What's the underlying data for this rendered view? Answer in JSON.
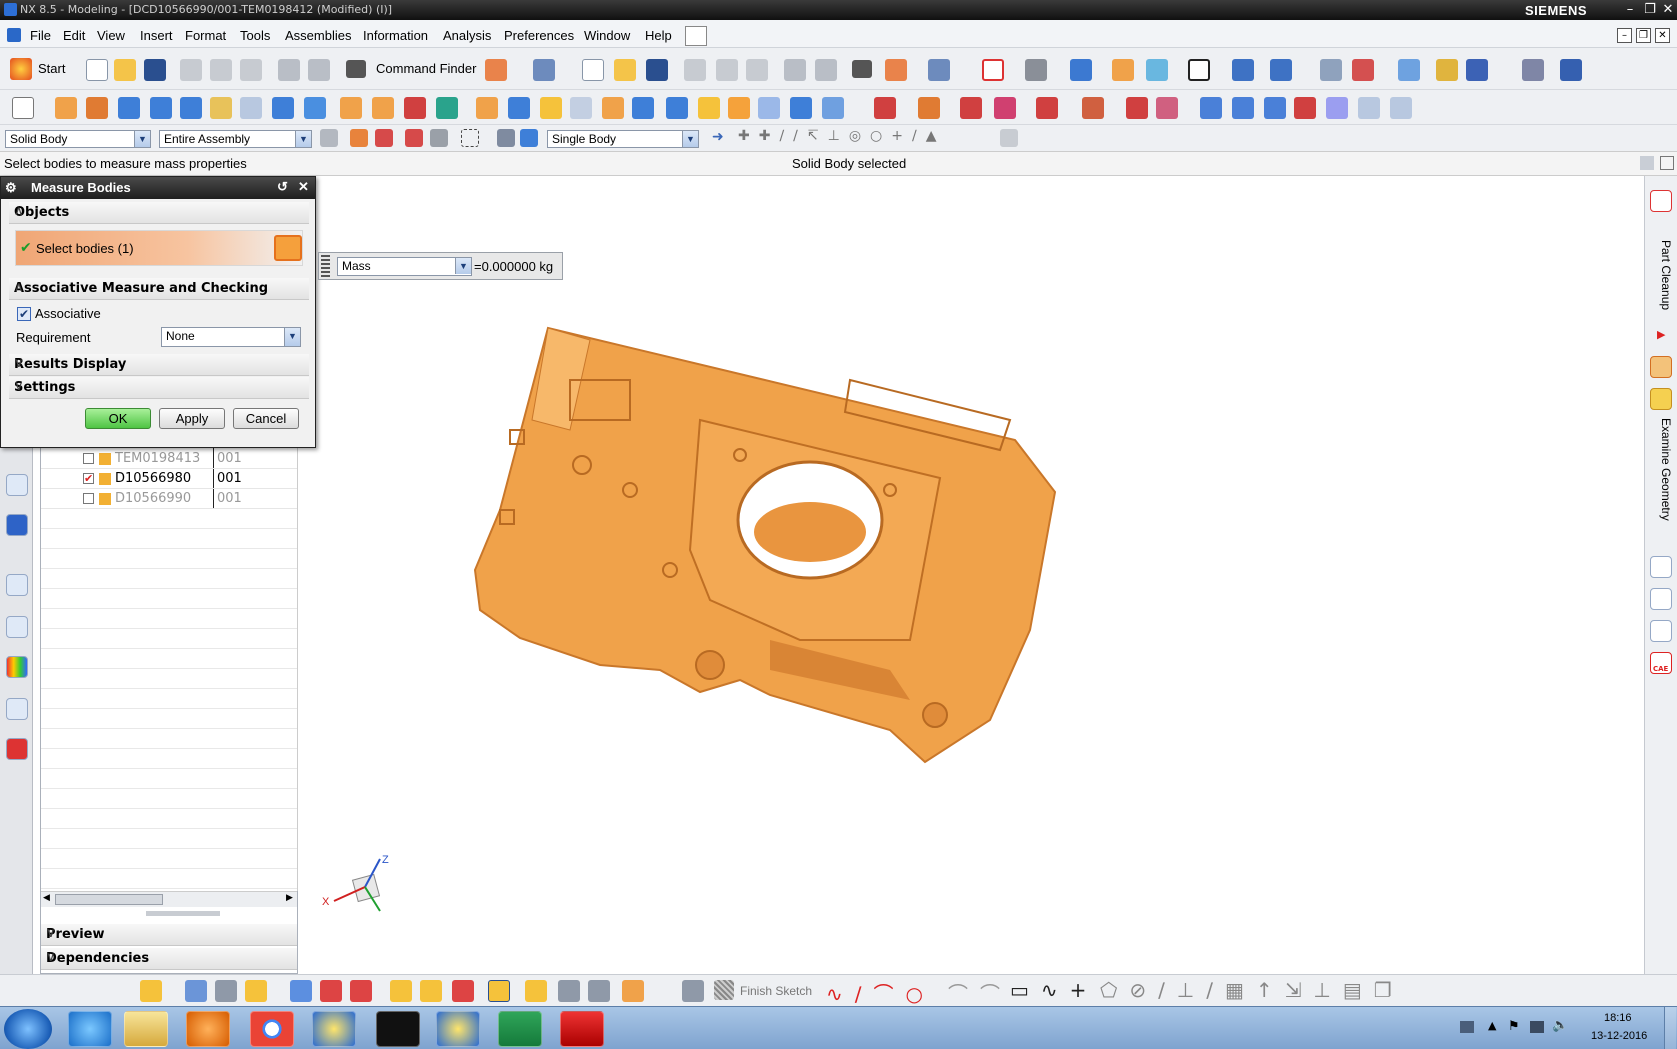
{
  "window": {
    "title": "NX 8.5 - Modeling - [DCD10566990/001-TEM0198412 (Modified)   (I)]",
    "brand": "SIEMENS"
  },
  "menu": [
    "File",
    "Edit",
    "View",
    "Insert",
    "Format",
    "Tools",
    "Assemblies",
    "Information",
    "Analysis",
    "Preferences",
    "Window",
    "Help"
  ],
  "toolbar": {
    "start_label": "Start",
    "command_finder_label": "Command Finder"
  },
  "selection_bar": {
    "type_filter": "Solid Body",
    "scope": "Entire Assembly",
    "body_rule": "Single Body"
  },
  "cue_line": {
    "prompt": "Select bodies to measure mass properties",
    "status": "Solid Body selected"
  },
  "dialog": {
    "title": "Measure Bodies",
    "objects_group": "Objects",
    "select_bodies_label": "Select bodies (1)",
    "assoc_group": "Associative Measure and Checking",
    "associative_label": "Associative",
    "associative_checked": true,
    "requirement_label": "Requirement",
    "requirement_value": "None",
    "results_group": "Results Display",
    "settings_group": "Settings",
    "ok_label": "OK",
    "apply_label": "Apply",
    "cancel_label": "Cancel"
  },
  "measure_readout": {
    "quantity": "Mass",
    "value": "=0.000000 kg"
  },
  "navigator": {
    "rows": [
      {
        "name": "TEM0198413",
        "rev": "001",
        "checked": false,
        "dim": true
      },
      {
        "name": "D10566980",
        "rev": "001",
        "checked": true,
        "dim": false
      },
      {
        "name": "D10566990",
        "rev": "001",
        "checked": false,
        "dim": true
      }
    ],
    "preview_label": "Preview",
    "dependencies_label": "Dependencies"
  },
  "right_rail": {
    "tab1": "Part Cleanup",
    "tab2": "Examine Geometry",
    "cae_label": "CAE"
  },
  "bottom_toolbar": {
    "finish_sketch_label": "Finish Sketch"
  },
  "triad": {
    "x": "X",
    "z": "Z"
  },
  "taskbar": {
    "time": "18:16",
    "date": "13-12-2016"
  },
  "colors": {
    "model": "#f0a24a",
    "highlight": "#f3b07a",
    "titlebar": "#1e1e1e",
    "ok_button": "#5fcf55"
  }
}
